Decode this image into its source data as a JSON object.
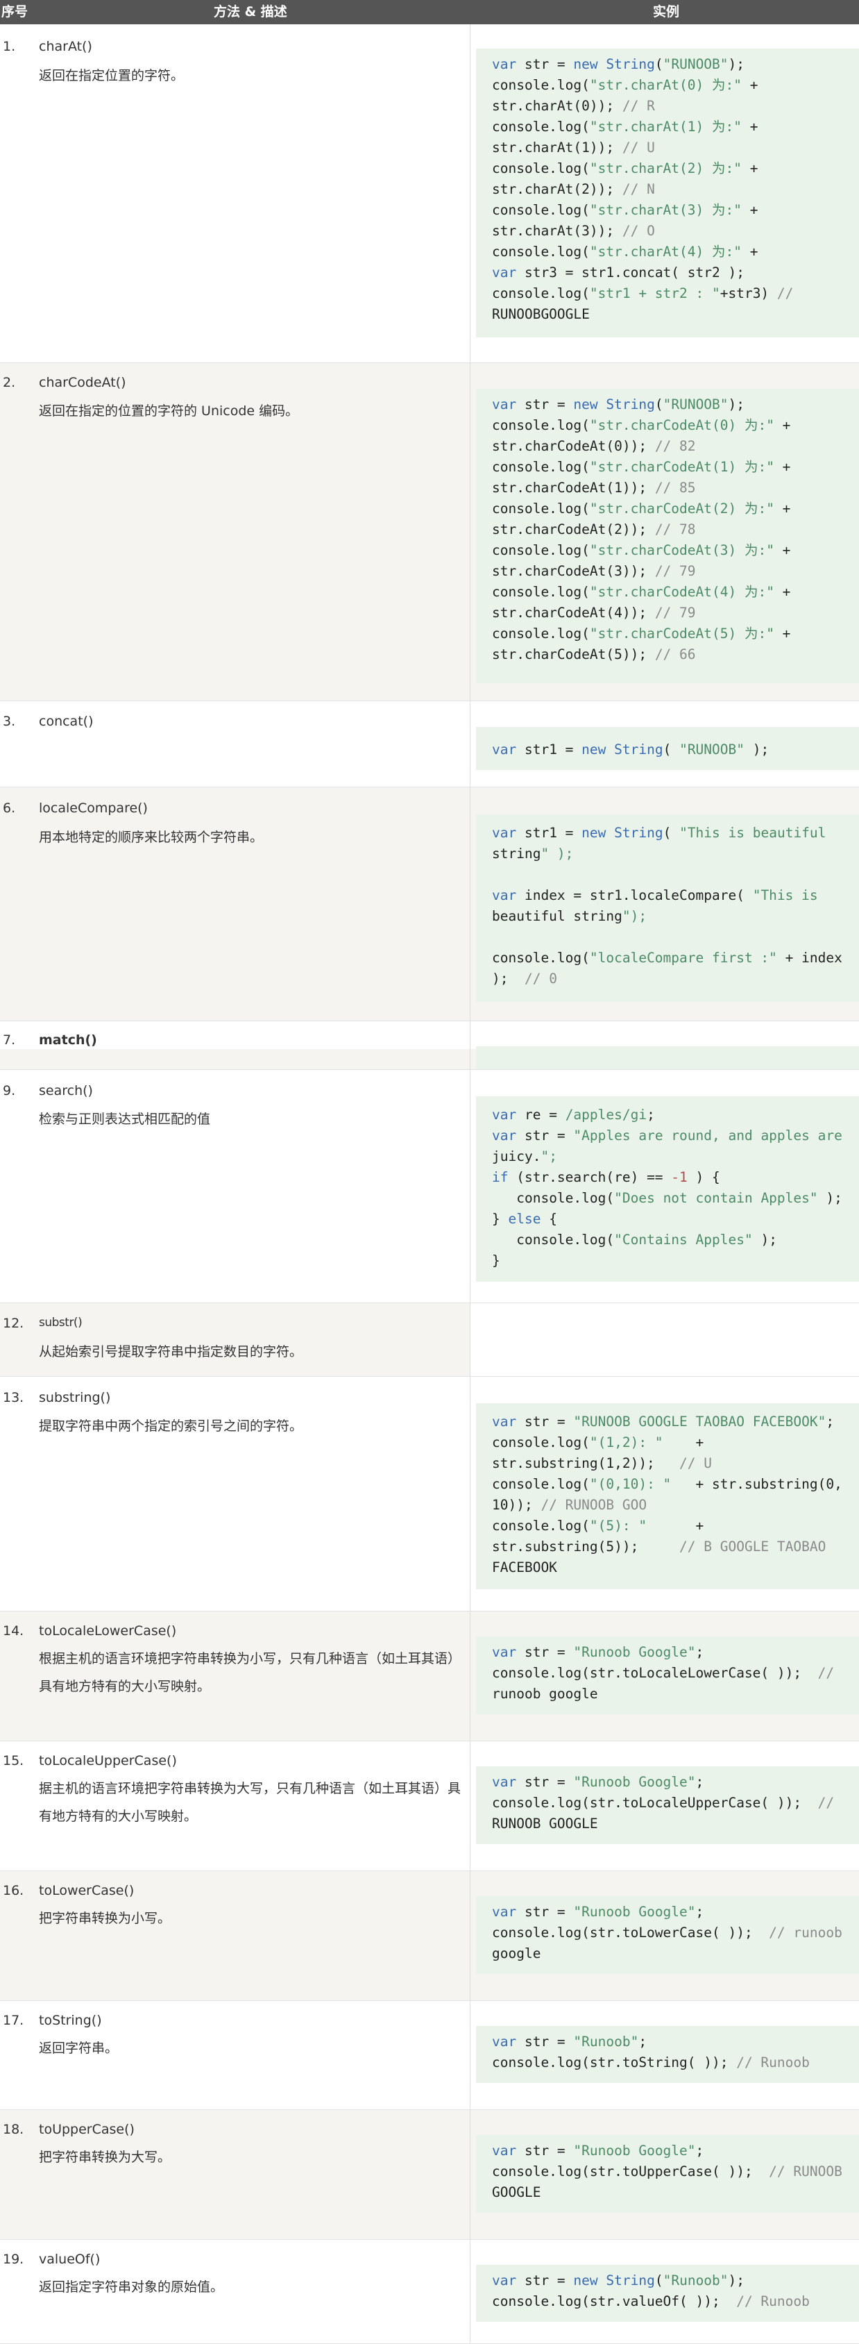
{
  "header": {
    "col_num": "序号",
    "col_method": "方法 & 描述",
    "col_example": "实例"
  },
  "rows": [
    {
      "num": "1.",
      "name": "charAt()",
      "desc": "返回在指定位置的字符。",
      "code_lines": [
        "var str = new String(\"RUNOOB\");",
        "console.log(\"str.charAt(0) 为:\" +",
        "str.charAt(0)); // R",
        "console.log(\"str.charAt(1) 为:\" +",
        "str.charAt(1)); // U",
        "console.log(\"str.charAt(2) 为:\" +",
        "str.charAt(2)); // N",
        "console.log(\"str.charAt(3) 为:\" +",
        "str.charAt(3)); // O",
        "console.log(\"str.charAt(4) 为:\" +",
        "var str3 = str1.concat( str2 );",
        "console.log(\"str1 + str2 : \"+str3) //",
        "RUNOOBGOOGLE"
      ]
    },
    {
      "num": "2.",
      "name": "charCodeAt()",
      "desc": "返回在指定的位置的字符的 Unicode 编码。",
      "code_lines": [
        "var str = new String(\"RUNOOB\");",
        "console.log(\"str.charCodeAt(0) 为:\" +",
        "str.charCodeAt(0)); // 82",
        "console.log(\"str.charCodeAt(1) 为:\" +",
        "str.charCodeAt(1)); // 85",
        "console.log(\"str.charCodeAt(2) 为:\" +",
        "str.charCodeAt(2)); // 78",
        "console.log(\"str.charCodeAt(3) 为:\" +",
        "str.charCodeAt(3)); // 79",
        "console.log(\"str.charCodeAt(4) 为:\" +",
        "str.charCodeAt(4)); // 79",
        "console.log(\"str.charCodeAt(5) 为:\" +",
        "str.charCodeAt(5)); // 66"
      ]
    },
    {
      "num": "3.",
      "name": "concat()",
      "desc": "",
      "code_lines": [
        "var str1 = new String( \"RUNOOB\" );"
      ]
    },
    {
      "num": "6.",
      "name": "localeCompare()",
      "desc": "用本地特定的顺序来比较两个字符串。",
      "code_lines": [
        "var str1 = new String( \"This is beautiful",
        "string\" );",
        "",
        "var index = str1.localeCompare( \"This is",
        "beautiful string\");",
        "",
        "console.log(\"localeCompare first :\" + index",
        ");  // 0"
      ]
    },
    {
      "num": "7.",
      "name": "match()",
      "desc": "",
      "code_lines": []
    },
    {
      "num": "9.",
      "name": "search()",
      "desc": "检索与正则表达式相匹配的值",
      "code_lines": [
        "var re = /apples/gi;",
        "var str = \"Apples are round, and apples are",
        "juicy.\";",
        "if (str.search(re) == -1 ) {",
        "   console.log(\"Does not contain Apples\" );",
        "} else {",
        "   console.log(\"Contains Apples\" );",
        "}"
      ]
    },
    {
      "num": "12.",
      "name": "substr()",
      "desc": "从起始索引号提取字符串中指定数目的字符。",
      "code_lines": []
    },
    {
      "num": "13.",
      "name": "substring()",
      "desc": "提取字符串中两个指定的索引号之间的字符。",
      "code_lines": [
        "var str = \"RUNOOB GOOGLE TAOBAO FACEBOOK\";",
        "console.log(\"(1,2): \"    +",
        "str.substring(1,2));   // U",
        "console.log(\"(0,10): \"   + str.substring(0,",
        "10)); // RUNOOB GOO",
        "console.log(\"(5): \"      +",
        "str.substring(5));     // B GOOGLE TAOBAO",
        "FACEBOOK"
      ]
    },
    {
      "num": "14.",
      "name": "toLocaleLowerCase()",
      "desc": "根据主机的语言环境把字符串转换为小写，只有几种语言（如土耳其语）具有地方特有的大小写映射。",
      "code_lines": [
        "var str = \"Runoob Google\";",
        "console.log(str.toLocaleLowerCase( ));  //",
        "runoob google"
      ]
    },
    {
      "num": "15.",
      "name": "toLocaleUpperCase()",
      "desc": "据主机的语言环境把字符串转换为大写，只有几种语言（如土耳其语）具有地方特有的大小写映射。",
      "code_lines": [
        "var str = \"Runoob Google\";",
        "console.log(str.toLocaleUpperCase( ));  //",
        "RUNOOB GOOGLE"
      ]
    },
    {
      "num": "16.",
      "name": "toLowerCase()",
      "desc": "把字符串转换为小写。",
      "code_lines": [
        "var str = \"Runoob Google\";",
        "console.log(str.toLowerCase( ));  // runoob",
        "google"
      ]
    },
    {
      "num": "17.",
      "name": "toString()",
      "desc": "返回字符串。",
      "code_lines": [
        "var str = \"Runoob\";",
        "console.log(str.toString( )); // Runoob"
      ]
    },
    {
      "num": "18.",
      "name": "toUpperCase()",
      "desc": "把字符串转换为大写。",
      "code_lines": [
        "var str = \"Runoob Google\";",
        "console.log(str.toUpperCase( ));  // RUNOOB",
        "GOOGLE"
      ]
    },
    {
      "num": "19.",
      "name": "valueOf()",
      "desc": "返回指定字符串对象的原始值。",
      "code_lines": [
        "var str = new String(\"Runoob\");",
        "console.log(str.valueOf( ));  // Runoob"
      ]
    }
  ]
}
